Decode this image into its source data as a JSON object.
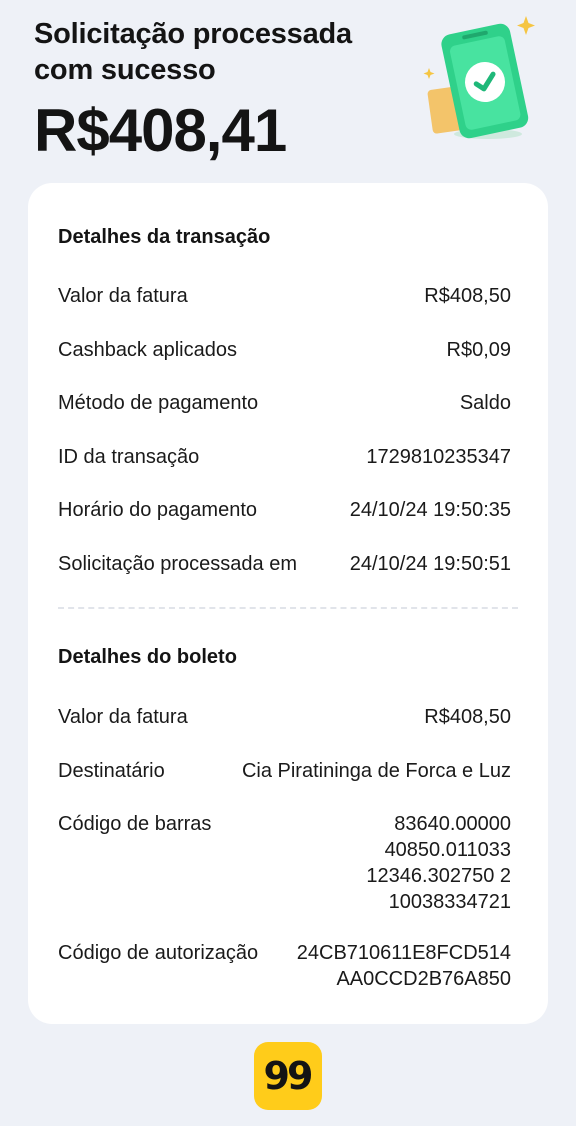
{
  "header": {
    "title_line1": "Solicitação processada",
    "title_line2": "com sucesso",
    "amount": "R$408,41"
  },
  "transaction": {
    "title": "Detalhes da transação",
    "rows": [
      {
        "label": "Valor da fatura",
        "value": "R$408,50"
      },
      {
        "label": "Cashback aplicados",
        "value": "R$0,09"
      },
      {
        "label": "Método de pagamento",
        "value": "Saldo"
      },
      {
        "label": "ID da transação",
        "value": "1729810235347"
      },
      {
        "label": "Horário do pagamento",
        "value": "24/10/24 19:50:35"
      },
      {
        "label": "Solicitação processada em",
        "value": "24/10/24 19:50:51"
      }
    ]
  },
  "boleto": {
    "title": "Detalhes do boleto",
    "invoice_label": "Valor da fatura",
    "invoice_value": "R$408,50",
    "recipient_label": "Destinatário",
    "recipient_value": "Cia Piratininga de Forca e Luz",
    "barcode_label": "Código de barras",
    "barcode_lines": [
      "83640.00000",
      "40850.011033",
      "12346.302750 2",
      "10038334721"
    ],
    "auth_label": "Código de autorização",
    "auth_lines": [
      "24CB710611E8FCD514",
      "AA0CCD2B76A850"
    ]
  },
  "logo": {
    "text": "99",
    "color": "#ffcc1a"
  },
  "icons": {
    "illustration": "receipt-check-icon"
  },
  "colors": {
    "background": "#eef1f7",
    "card": "#ffffff",
    "accent_green": "#2fd18a"
  }
}
